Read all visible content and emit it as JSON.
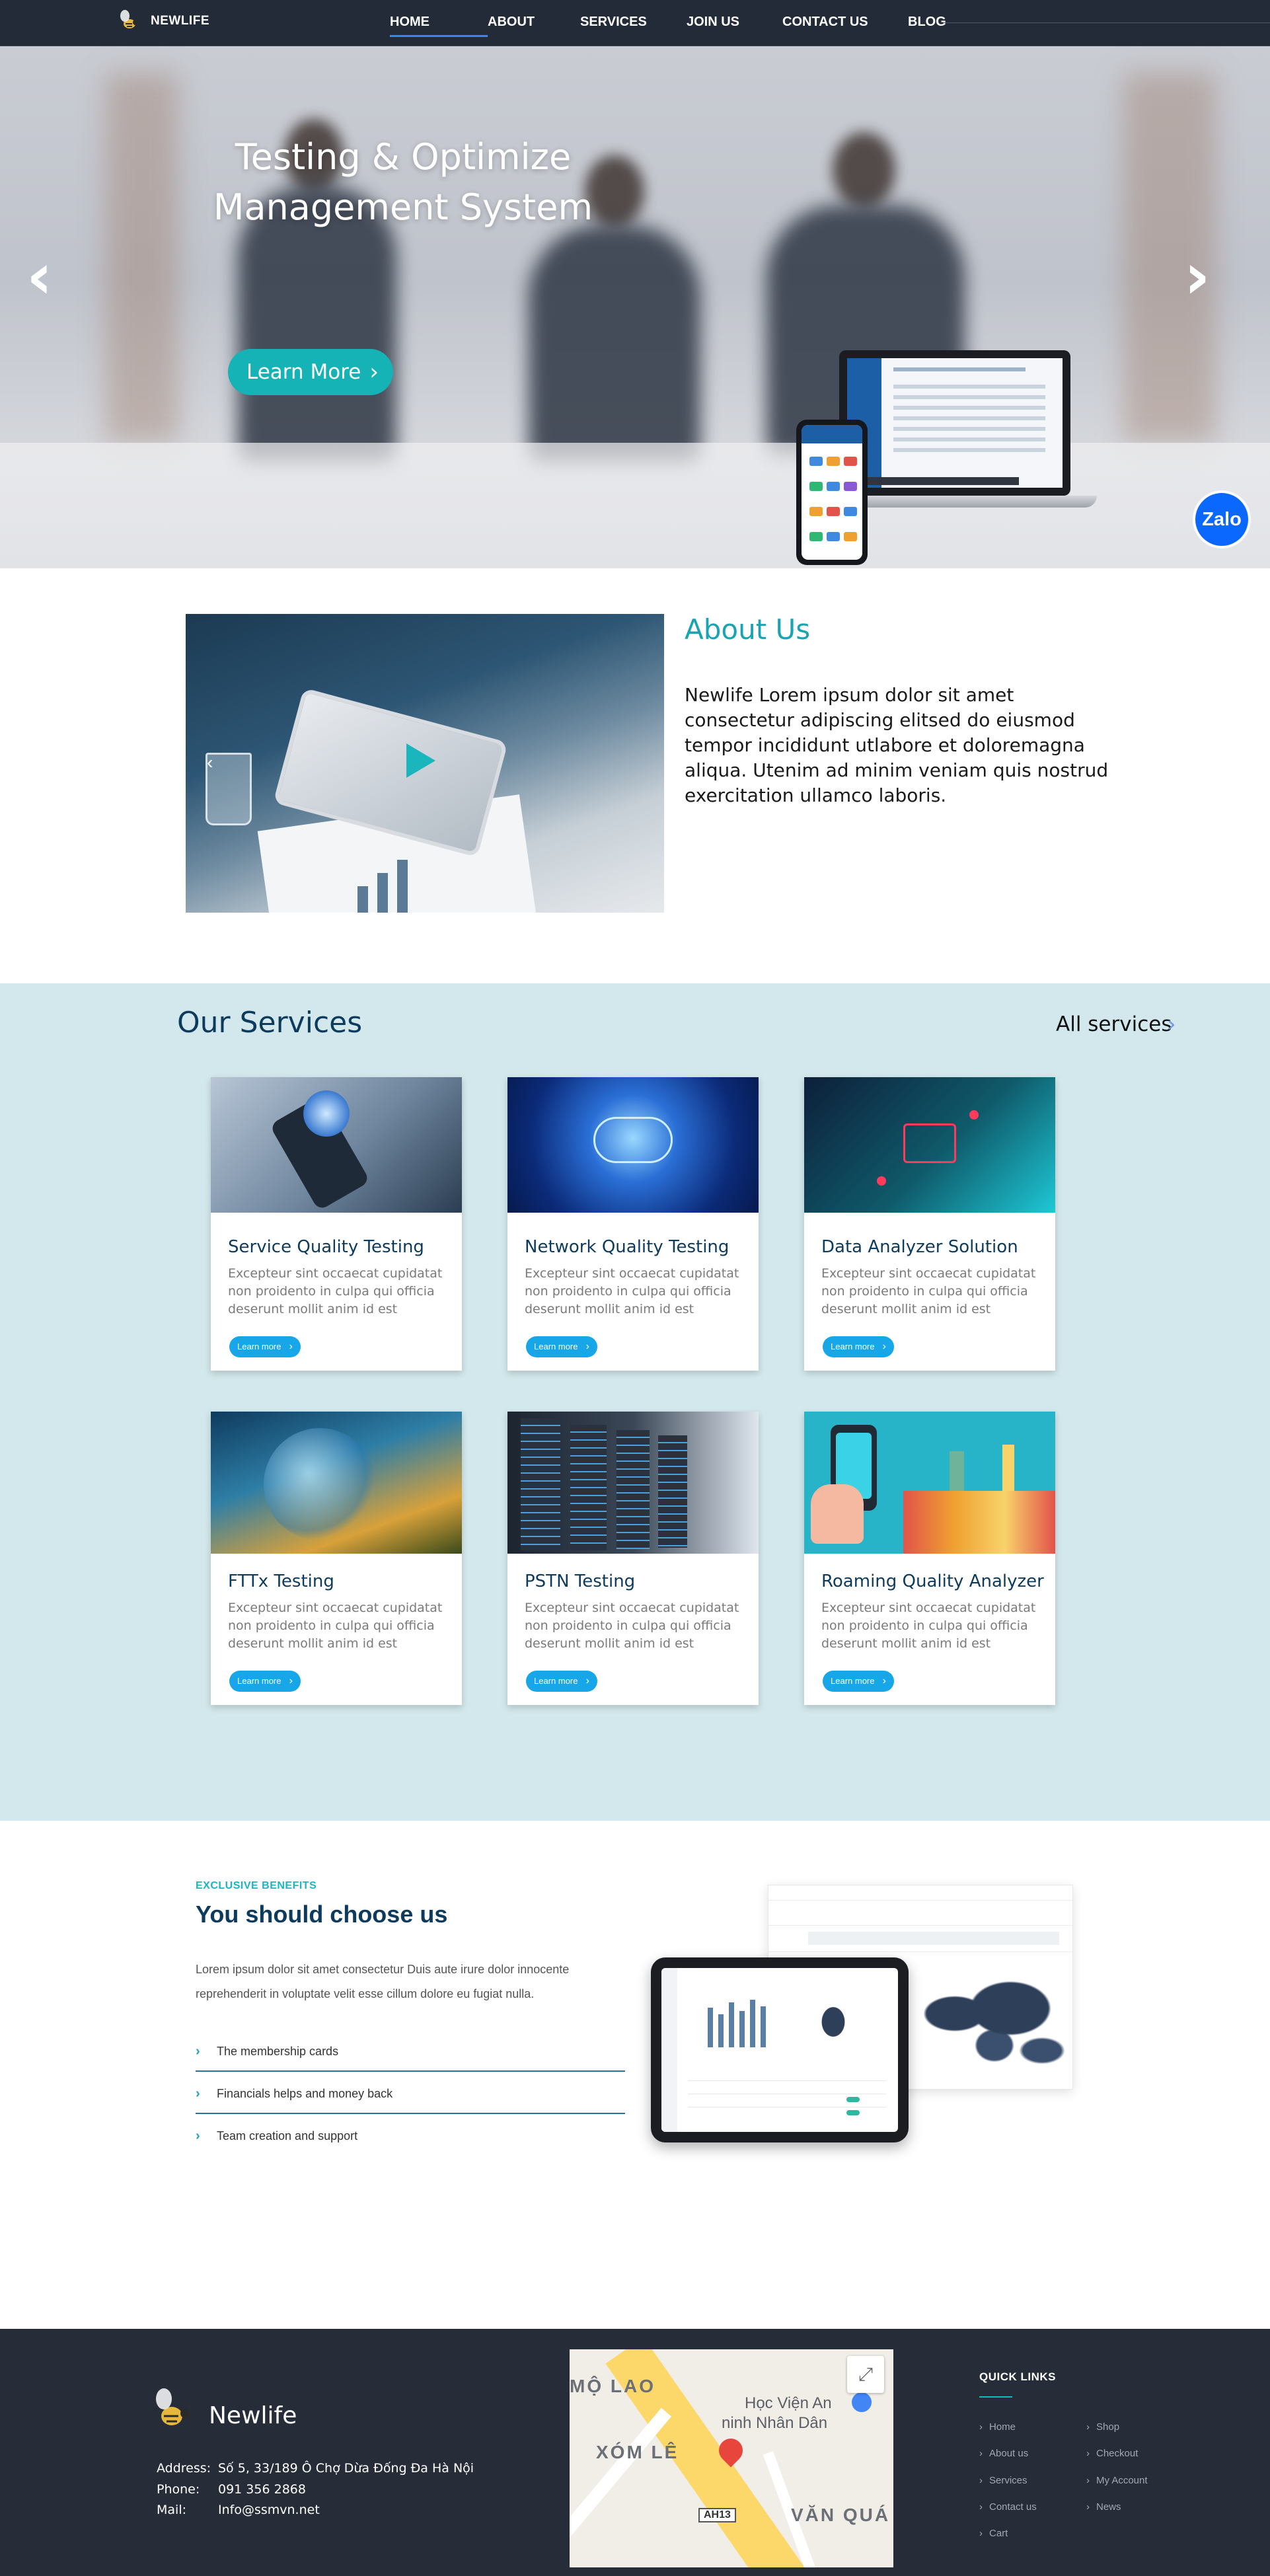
{
  "nav": {
    "brand": "NEWLIFE",
    "items": [
      {
        "label": "HOME",
        "active": true
      },
      {
        "label": "ABOUT",
        "active": false
      },
      {
        "label": "SERVICES",
        "active": false
      },
      {
        "label": "JOIN US",
        "active": false
      },
      {
        "label": "CONTACT US",
        "active": false
      },
      {
        "label": "BLOG",
        "active": false
      }
    ]
  },
  "hero": {
    "title_line1": "Testing & Optimize",
    "title_line2": "Management System",
    "button": "Learn More",
    "prev_icon": "chevron-left",
    "next_icon": "chevron-right",
    "chat_widget": "Zalo"
  },
  "about": {
    "title": "About Us",
    "text": "Newlife Lorem ipsum dolor sit amet consectetur adipiscing elitsed do eiusmod tempor incididunt utlabore et doloremagna aliqua. Utenim ad minim veniam quis nostrud exercitation ullamco laboris."
  },
  "services": {
    "title": "Our Services",
    "all_link": "All services",
    "cards": [
      {
        "title": "Service Quality Testing",
        "desc": "Excepteur sint occaecat cupidatat non proidento in culpa qui officia deserunt mollit anim id est",
        "button": "Learn more"
      },
      {
        "title": "Network Quality Testing",
        "desc": "Excepteur sint occaecat cupidatat non proidento in culpa qui officia deserunt mollit anim id est",
        "button": "Learn more"
      },
      {
        "title": "Data Analyzer Solution",
        "desc": "Excepteur sint occaecat cupidatat non proidento in culpa qui officia deserunt mollit anim id est",
        "button": "Learn more"
      },
      {
        "title": "FTTx Testing",
        "desc": "Excepteur sint occaecat cupidatat non proidento in culpa qui officia deserunt mollit anim id est",
        "button": "Learn more"
      },
      {
        "title": "PSTN Testing",
        "desc": "Excepteur sint occaecat cupidatat non proidento in culpa qui officia deserunt mollit anim id est",
        "button": "Learn more"
      },
      {
        "title": "Roaming Quality Analyzer",
        "desc": "Excepteur sint occaecat cupidatat non proidento in culpa qui officia deserunt mollit anim id est",
        "button": "Learn more"
      }
    ]
  },
  "why": {
    "eyebrow": "EXCLUSIVE BENEFITS",
    "title": "You should choose us",
    "text": "Lorem ipsum dolor sit amet consectetur Duis aute irure dolor innocente reprehenderit in voluptate velit esse cillum dolore eu fugiat nulla.",
    "items": [
      "The membership cards",
      "Financials helps and money back",
      "Team creation and support"
    ]
  },
  "footer": {
    "brand": "Newlife",
    "address_label": "Address:",
    "address": "Số 5, 33/189 Ô Chợ Dừa Đống Đa Hà Nội",
    "phone_label": "Phone:",
    "phone": "091 356 2868",
    "mail_label": "Mail:",
    "mail": "Info@ssmvn.net",
    "map_labels": [
      "MỘ LAO",
      "XÓM LÊ",
      "VĂN QUÁ",
      "Học Viện An",
      "ninh Nhân Dân",
      "AH13"
    ],
    "quick_links_title": "QUICK LINKS",
    "quick_links_left": [
      "Home",
      "About us",
      "Services",
      "Contact us",
      "Cart"
    ],
    "quick_links_right": [
      "Shop",
      "Checkout",
      "My Account",
      "News"
    ]
  },
  "colors": {
    "nav_bg": "#242b38",
    "accent_teal": "#15b3b5",
    "accent_blue": "#17a7e8",
    "heading_navy": "#0d3b5e",
    "services_bg": "#d3e8ec",
    "footer_bg": "#262c38"
  }
}
